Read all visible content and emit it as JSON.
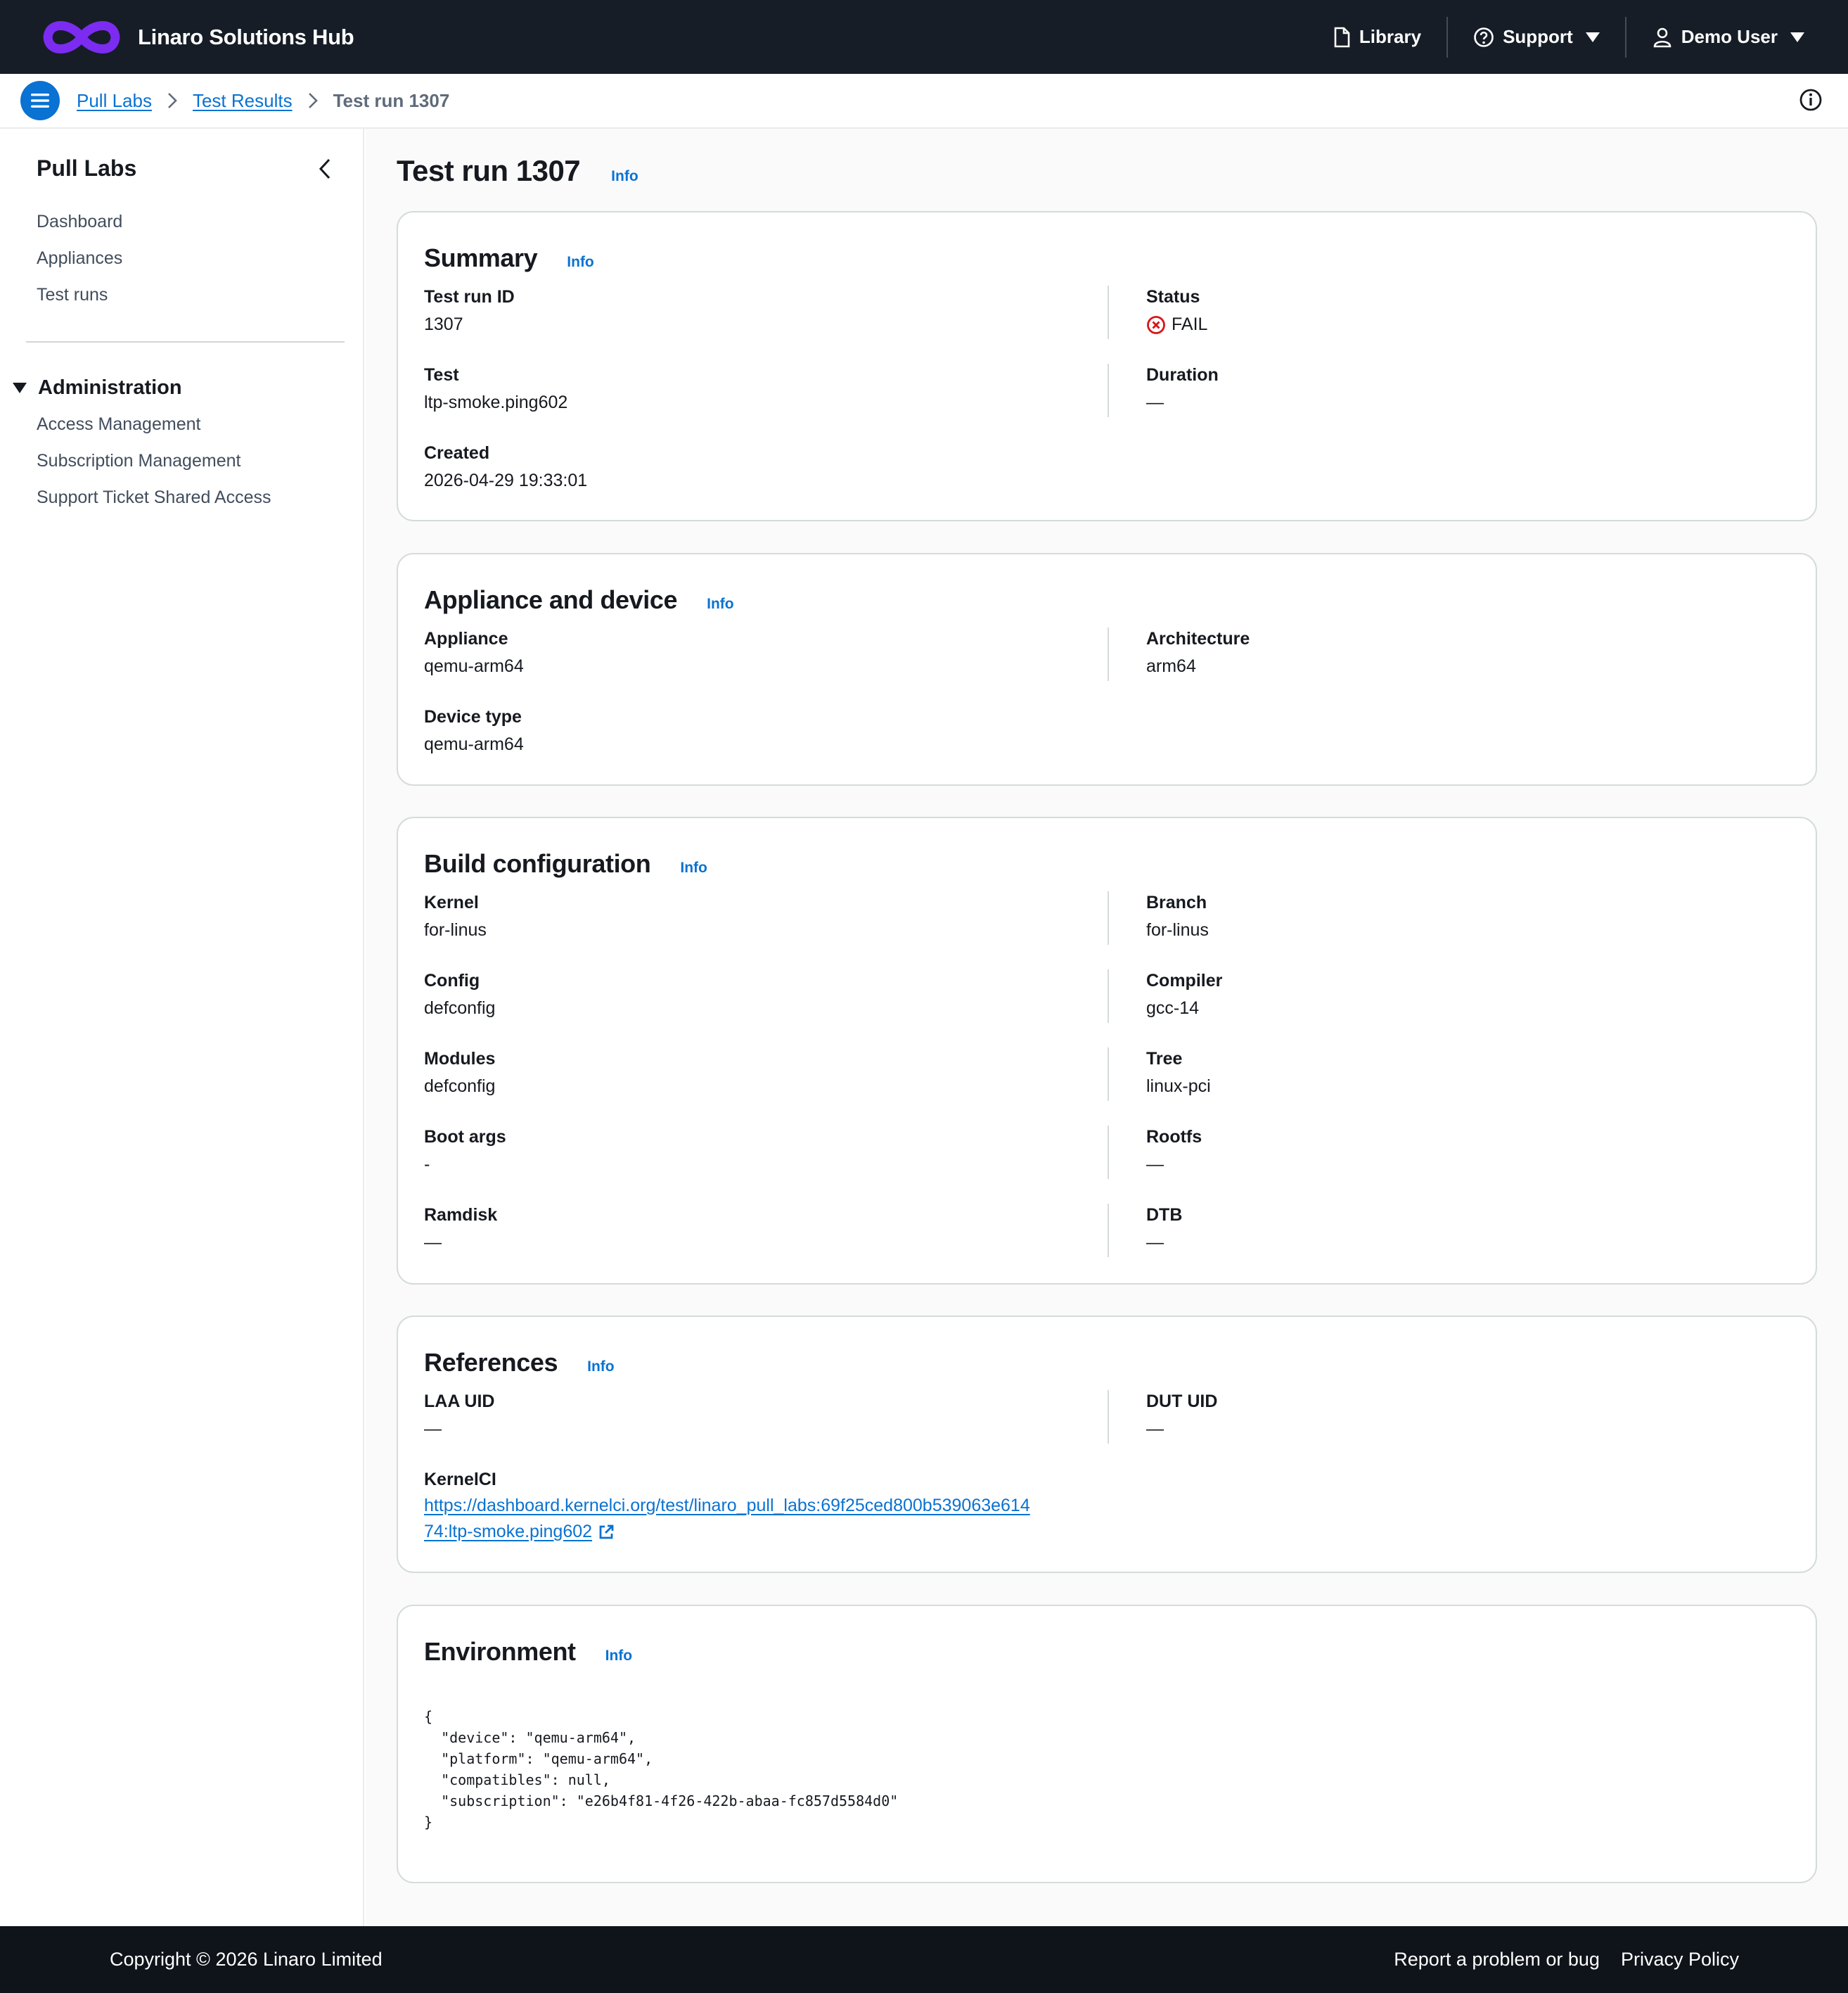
{
  "header": {
    "brand": "Linaro Solutions Hub",
    "library": "Library",
    "support": "Support",
    "user": "Demo User"
  },
  "breadcrumb": {
    "items": [
      "Pull Labs",
      "Test Results"
    ],
    "current": "Test run 1307"
  },
  "sidebar": {
    "title": "Pull Labs",
    "items": [
      "Dashboard",
      "Appliances",
      "Test runs"
    ],
    "section": "Administration",
    "admin_items": [
      "Access Management",
      "Subscription Management",
      "Support Ticket Shared Access"
    ]
  },
  "page": {
    "title": "Test run 1307",
    "info": "Info"
  },
  "summary": {
    "title": "Summary",
    "test_run_id_label": "Test run ID",
    "test_run_id": "1307",
    "status_label": "Status",
    "status": "FAIL",
    "test_label": "Test",
    "test": "ltp-smoke.ping602",
    "duration_label": "Duration",
    "duration": "—",
    "created_label": "Created",
    "created": "2026-04-29 19:33:01"
  },
  "appliance": {
    "title": "Appliance and device",
    "appliance_label": "Appliance",
    "appliance": "qemu-arm64",
    "architecture_label": "Architecture",
    "architecture": "arm64",
    "device_type_label": "Device type",
    "device_type": "qemu-arm64"
  },
  "build": {
    "title": "Build configuration",
    "kernel_label": "Kernel",
    "kernel": "for-linus",
    "branch_label": "Branch",
    "branch": "for-linus",
    "config_label": "Config",
    "config": "defconfig",
    "compiler_label": "Compiler",
    "compiler": "gcc-14",
    "modules_label": "Modules",
    "modules": "defconfig",
    "tree_label": "Tree",
    "tree": "linux-pci",
    "boot_args_label": "Boot args",
    "boot_args": "-",
    "rootfs_label": "Rootfs",
    "rootfs": "—",
    "ramdisk_label": "Ramdisk",
    "ramdisk": "—",
    "dtb_label": "DTB",
    "dtb": "—"
  },
  "references": {
    "title": "References",
    "laa_uid_label": "LAA UID",
    "laa_uid": "—",
    "dut_uid_label": "DUT UID",
    "dut_uid": "—",
    "kernelci_label": "KernelCI",
    "kernelci_line1": "https://dashboard.kernelci.org/test/linaro_pull_labs:69f25ced800b539063e614",
    "kernelci_line2": "74:ltp-smoke.ping602"
  },
  "environment": {
    "title": "Environment",
    "json": "{\n  \"device\": \"qemu-arm64\",\n  \"platform\": \"qemu-arm64\",\n  \"compatibles\": null,\n  \"subscription\": \"e26b4f81-4f26-422b-abaa-fc857d5584d0\"\n}"
  },
  "footer": {
    "copyright": "Copyright © 2026 Linaro Limited",
    "report": "Report a problem or bug",
    "privacy": "Privacy Policy"
  },
  "colors": {
    "nav_bg": "#161d26",
    "accent": "#0972d3",
    "error": "#d91515",
    "logo": "#7b2cf0"
  }
}
